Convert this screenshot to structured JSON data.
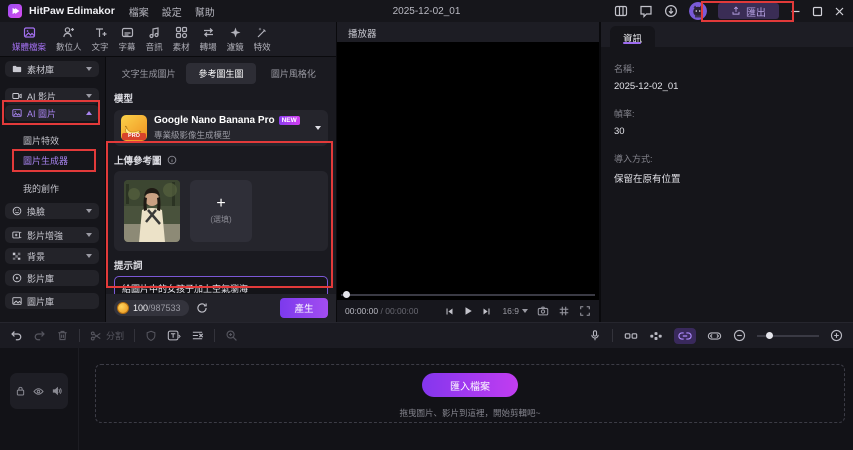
{
  "titlebar": {
    "app_name": "HitPaw Edimakor",
    "menus": [
      "檔案",
      "設定",
      "幫助"
    ],
    "project_title": "2025-12-02_01",
    "export_label": "匯出"
  },
  "media_toolbar": {
    "items": [
      {
        "label": "媒體檔案",
        "active": true
      },
      {
        "label": "數位人",
        "active": false
      },
      {
        "label": "文字",
        "active": false
      },
      {
        "label": "字幕",
        "active": false
      },
      {
        "label": "音訊",
        "active": false
      },
      {
        "label": "素材",
        "active": false
      },
      {
        "label": "轉場",
        "active": false
      },
      {
        "label": "濾鏡",
        "active": false
      },
      {
        "label": "特效",
        "active": false
      }
    ]
  },
  "sidebar": {
    "items": [
      {
        "label": "素材庫"
      },
      {
        "label": "AI 影片"
      },
      {
        "label": "AI 圖片"
      },
      {
        "label": "圖片特效"
      },
      {
        "label": "圖片生成器"
      },
      {
        "label": "我的創作"
      },
      {
        "label": "換臉"
      },
      {
        "label": "影片增強"
      },
      {
        "label": "背景"
      },
      {
        "label": "影片庫"
      },
      {
        "label": "圖片庫"
      }
    ]
  },
  "generator": {
    "tabs": [
      {
        "label": "文字生成圖片"
      },
      {
        "label": "參考圖生圖"
      },
      {
        "label": "圖片風格化"
      }
    ],
    "model_label": "模型",
    "model_name": "Google Nano Banana Pro",
    "model_badge": "NEW",
    "model_pro": "PRO",
    "model_subtitle": "專業級影像生成模型",
    "upload_label": "上傳參考圖",
    "add_symbol": "+",
    "optional_hint": "(選填)",
    "prompt_label": "提示詞",
    "prompt_value": "給圖片中的女孩子加上空氣瀏海",
    "credits_used": "100",
    "credits_total": "/987533",
    "generate_label": "產生"
  },
  "player": {
    "title": "播放器",
    "time_current": "00:00:00",
    "time_separator": "/",
    "time_total": "00:00:00",
    "aspect_ratio": "16:9"
  },
  "info": {
    "tab_label": "資訊",
    "fields": [
      {
        "label": "名稱:",
        "value": "2025-12-02_01"
      },
      {
        "label": "幀率:",
        "value": "30"
      },
      {
        "label": "導入方式:",
        "value": "保留在原有位置"
      }
    ]
  },
  "timeline": {
    "split_label": "分割"
  },
  "dropzone": {
    "import_label": "匯入檔案",
    "hint": "拖曳圖片、影片到這裡，開始剪輯吧~"
  },
  "colors": {
    "accent_purple": "#a471f2",
    "annotation_red": "#e23a3a",
    "generate_gradient": "#7c3aed → #a34df0",
    "import_gradient": "#8436ee → #c13df0"
  }
}
